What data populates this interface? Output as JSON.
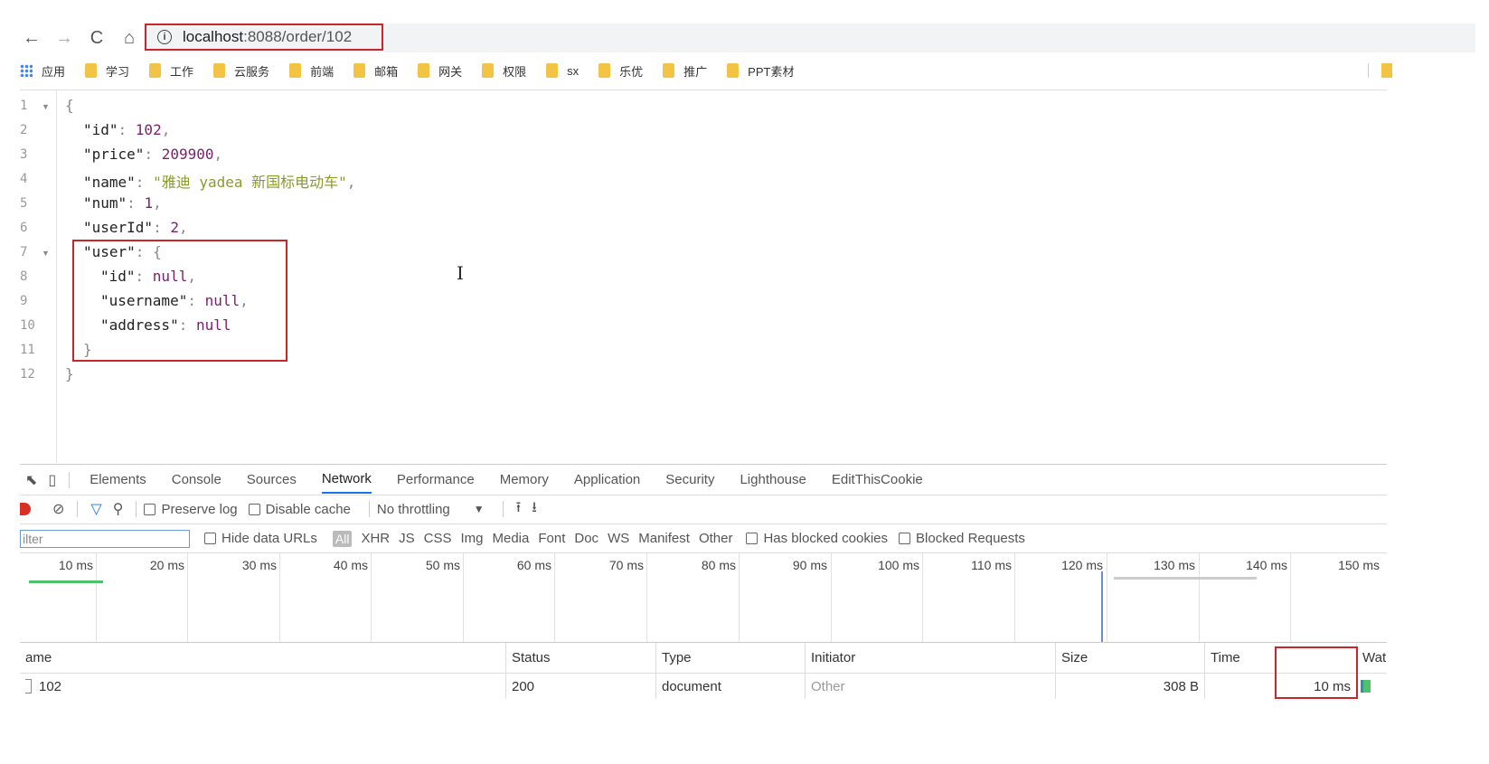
{
  "browser": {
    "url_host": "localhost",
    "url_path": ":8088/order/102",
    "nav": {
      "back": "←",
      "forward": "→",
      "reload": "C",
      "home": "⌂"
    }
  },
  "bookmarks": [
    "应用",
    "学习",
    "工作",
    "云服务",
    "前端",
    "邮箱",
    "网关",
    "权限",
    "sx",
    "乐优",
    "推广",
    "PPT素材"
  ],
  "json_view": {
    "line_numbers": [
      "1",
      "2",
      "3",
      "4",
      "5",
      "6",
      "7",
      "8",
      "9",
      "10",
      "11",
      "12"
    ],
    "lines": {
      "open": "{",
      "id_key": "\"id\"",
      "id_val": "102",
      "price_key": "\"price\"",
      "price_val": "209900",
      "name_key": "\"name\"",
      "name_val": "\"雅迪 yadea 新国标电动车\"",
      "num_key": "\"num\"",
      "num_val": "1",
      "userid_key": "\"userId\"",
      "userid_val": "2",
      "user_key": "\"user\"",
      "user_open": "{",
      "uid_key": "\"id\"",
      "uid_val": "null",
      "uname_key": "\"username\"",
      "uname_val": "null",
      "addr_key": "\"address\"",
      "addr_val": "null",
      "user_close": "}",
      "close": "}"
    }
  },
  "devtools": {
    "tabs": [
      "Elements",
      "Console",
      "Sources",
      "Network",
      "Performance",
      "Memory",
      "Application",
      "Security",
      "Lighthouse",
      "EditThisCookie"
    ],
    "active_tab": "Network",
    "toolbar": {
      "preserve_log": "Preserve log",
      "disable_cache": "Disable cache",
      "throttling": "No throttling"
    },
    "filter": {
      "placeholder": "ilter",
      "hide_data_urls": "Hide data URLs",
      "types": [
        "All",
        "XHR",
        "JS",
        "CSS",
        "Img",
        "Media",
        "Font",
        "Doc",
        "WS",
        "Manifest",
        "Other"
      ],
      "has_blocked_cookies": "Has blocked cookies",
      "blocked_requests": "Blocked Requests"
    },
    "timeline_ticks": [
      "10 ms",
      "20 ms",
      "30 ms",
      "40 ms",
      "50 ms",
      "60 ms",
      "70 ms",
      "80 ms",
      "90 ms",
      "100 ms",
      "110 ms",
      "120 ms",
      "130 ms",
      "140 ms",
      "150 ms"
    ],
    "table": {
      "headers": {
        "name": "ame",
        "status": "Status",
        "type": "Type",
        "initiator": "Initiator",
        "size": "Size",
        "time": "Time",
        "waterfall": "Wat"
      },
      "row": {
        "name": "102",
        "status": "200",
        "type": "document",
        "initiator": "Other",
        "size": "308 B",
        "time": "10 ms"
      }
    }
  }
}
